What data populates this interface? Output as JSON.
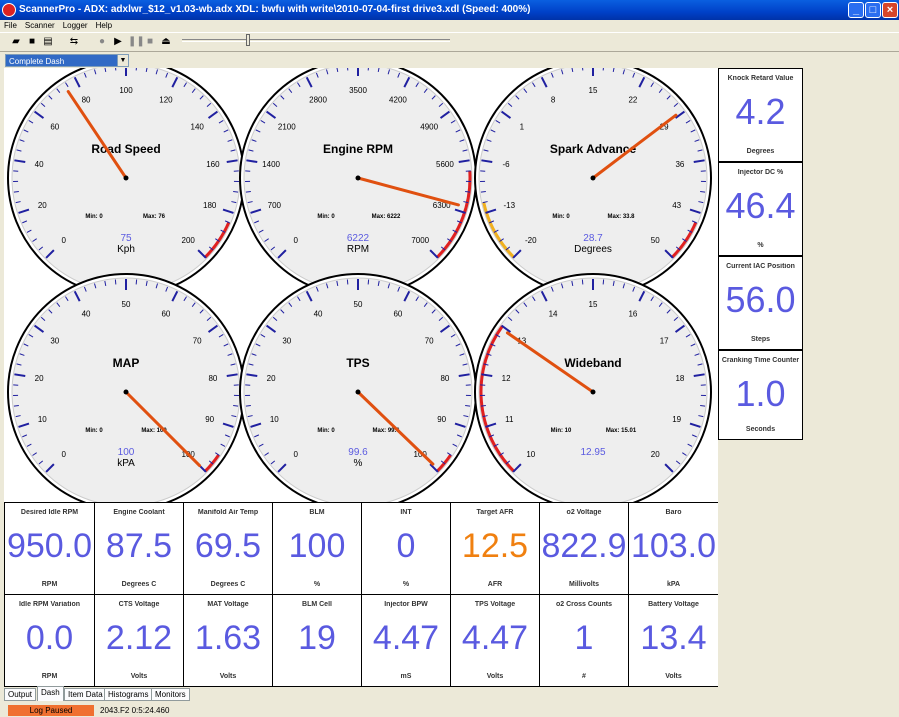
{
  "window": {
    "title": "ScannerPro - ADX: adxlwr_$12_v1.03-wb.adx  XDL: bwfu with write\\2010-07-04-first drive3.xdl (Speed: 400%)"
  },
  "menu": [
    "File",
    "Scanner",
    "Logger",
    "Help"
  ],
  "toolbar": {
    "icons": [
      "open-icon",
      "save-icon",
      "export-icon",
      "connect-icon",
      "record-icon",
      "play-icon",
      "pause-icon",
      "stop-icon",
      "eject-icon"
    ],
    "playback_position": 0.25
  },
  "dash_selector": {
    "value": "Complete Dash"
  },
  "gauges": [
    {
      "id": "road-speed",
      "title": "Road Speed",
      "value": "75",
      "unit": "Kph",
      "min": "Min: 0",
      "max": "Max: 76",
      "lo": 0,
      "hi": 200,
      "ticks": [
        "0",
        "20",
        "40",
        "60",
        "80",
        "100",
        "120",
        "140",
        "160",
        "180",
        "200"
      ],
      "needle": 75,
      "redFrom": 0.92,
      "yellowTo": 0
    },
    {
      "id": "engine-rpm",
      "title": "Engine RPM",
      "value": "6222",
      "unit": "RPM",
      "min": "Min: 0",
      "max": "Max: 6222",
      "lo": 0,
      "hi": 7000,
      "ticks": [
        "0",
        "700",
        "1400",
        "2100",
        "2800",
        "3500",
        "4200",
        "4900",
        "5600",
        "6300",
        "7000"
      ],
      "needle": 6222,
      "redFrom": 0.82,
      "yellowTo": 0
    },
    {
      "id": "spark-advance",
      "title": "Spark Advance",
      "value": "28.7",
      "unit": "Degrees",
      "min": "Min: 0",
      "max": "Max: 33.8",
      "lo": -20,
      "hi": 50,
      "ticks": [
        "-20",
        "-13",
        "-6",
        "1",
        "8",
        "15",
        "22",
        "29",
        "36",
        "43",
        "50"
      ],
      "needle": 28.7,
      "redFrom": 0.92,
      "yellowTo": 0.12
    },
    {
      "id": "map",
      "title": "MAP",
      "value": "100",
      "unit": "kPA",
      "min": "Min: 0",
      "max": "Max: 100",
      "lo": 0,
      "hi": 100,
      "ticks": [
        "0",
        "10",
        "20",
        "30",
        "40",
        "50",
        "60",
        "70",
        "80",
        "90",
        "100"
      ],
      "needle": 100,
      "redFrom": 0.96,
      "yellowTo": 0
    },
    {
      "id": "tps",
      "title": "TPS",
      "value": "99.6",
      "unit": "%",
      "min": "Min: 0",
      "max": "Max: 99.6",
      "lo": 0,
      "hi": 100,
      "ticks": [
        "0",
        "10",
        "20",
        "30",
        "40",
        "50",
        "60",
        "70",
        "80",
        "90",
        "100"
      ],
      "needle": 99.6,
      "redFrom": 0.96,
      "yellowTo": 0
    },
    {
      "id": "wideband",
      "title": "Wideband",
      "value": "12.95",
      "unit": "",
      "min": "Min: 10",
      "max": "Max: 15.01",
      "lo": 10,
      "hi": 20,
      "ticks": [
        "10",
        "11",
        "12",
        "13",
        "14",
        "15",
        "16",
        "17",
        "18",
        "19",
        "20"
      ],
      "needle": 12.95,
      "redFrom": 0,
      "yellowTo": 0,
      "redLow": 0.3
    }
  ],
  "side_panels": [
    {
      "title": "Knock Retard Value",
      "value": "4.2",
      "unit": "Degrees"
    },
    {
      "title": "Injector DC %",
      "value": "46.4",
      "unit": "%"
    },
    {
      "title": "Current IAC Position",
      "value": "56.0",
      "unit": "Steps"
    },
    {
      "title": "Cranking Time Counter",
      "value": "1.0",
      "unit": "Seconds"
    }
  ],
  "bottom_panels": [
    {
      "title": "Desired Idle RPM",
      "value": "950.0",
      "unit": "RPM"
    },
    {
      "title": "Engine Coolant",
      "value": "87.5",
      "unit": "Degrees C"
    },
    {
      "title": "Manifold Air Temp",
      "value": "69.5",
      "unit": "Degrees C"
    },
    {
      "title": "BLM",
      "value": "100",
      "unit": "%"
    },
    {
      "title": "INT",
      "value": "0",
      "unit": "%"
    },
    {
      "title": "Target AFR",
      "value": "12.5",
      "unit": "AFR",
      "accent": "orange"
    },
    {
      "title": "o2 Voltage",
      "value": "822.9",
      "unit": "Millivolts"
    },
    {
      "title": "Baro",
      "value": "103.0",
      "unit": "kPA"
    },
    {
      "title": "Idle RPM Variation",
      "value": "0.0",
      "unit": "RPM"
    },
    {
      "title": "CTS Voltage",
      "value": "2.12",
      "unit": "Volts"
    },
    {
      "title": "MAT Voltage",
      "value": "1.63",
      "unit": "Volts"
    },
    {
      "title": "BLM Cell",
      "value": "19",
      "unit": ""
    },
    {
      "title": "Injector BPW",
      "value": "4.47",
      "unit": "mS"
    },
    {
      "title": "TPS Voltage",
      "value": "4.47",
      "unit": "Volts"
    },
    {
      "title": "o2 Cross Counts",
      "value": "1",
      "unit": "#"
    },
    {
      "title": "Battery Voltage",
      "value": "13.4",
      "unit": "Volts"
    }
  ],
  "tabs": [
    "Output",
    "Dash",
    "Item Data",
    "Histograms",
    "Monitors"
  ],
  "status": {
    "log": "Log Paused",
    "time": "2043.F2  0:5:24.460"
  },
  "colors": {
    "value": "#5a5ae0",
    "accent_orange": "#f08010",
    "needle": "#e05010",
    "title_bar": "#0041c8"
  }
}
